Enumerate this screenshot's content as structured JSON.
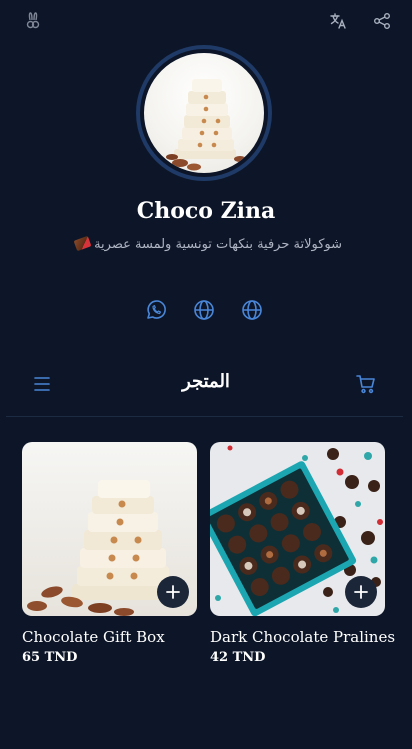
{
  "profile": {
    "name": "Choco Zina",
    "bio": "شوكولاتة حرفية بنكهات تونسية ولمسة عصرية"
  },
  "icons": {
    "top_left": "bunny-logo-icon",
    "translate": "translate-icon",
    "share": "share-icon",
    "whatsapp": "whatsapp-icon",
    "website": "globe-icon",
    "menu": "hamburger-menu-icon",
    "cart": "shopping-cart-icon",
    "add": "plus-icon"
  },
  "colors": {
    "background": "#0d1628",
    "accent": "#4a86d8",
    "avatar_ring": "#1f3a66"
  },
  "shop": {
    "title": "المتجر"
  },
  "products": [
    {
      "name": "Chocolate Gift Box",
      "price": "65 TND"
    },
    {
      "name": "Dark Chocolate Pralines",
      "price": "42 TND"
    }
  ]
}
